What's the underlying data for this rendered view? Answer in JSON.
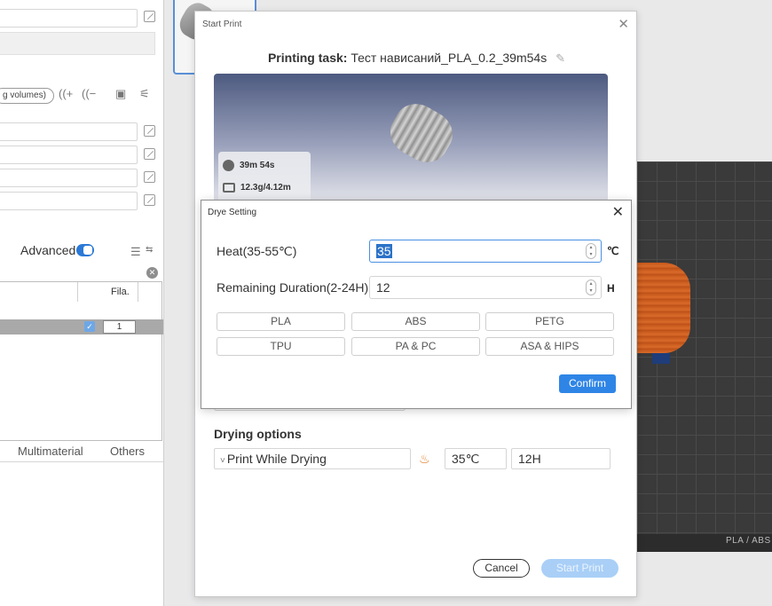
{
  "left_panel": {
    "volumes_pill": "g volumes)",
    "advanced_label": "Advanced",
    "table": {
      "column_fila": "Fila.",
      "row_value": "1"
    },
    "tabs": [
      "Multimaterial",
      "Others"
    ]
  },
  "plate": {
    "label": "PLA / ABS"
  },
  "start_print": {
    "title": "Start Print",
    "task_label": "Printing task:",
    "task_name": "Тест нависаний_PLA_0.2_39m54s",
    "time": "39m 54s",
    "filament": "12.3g/4.12m",
    "drying_title": "Drying options",
    "drying_mode": "Print While Drying",
    "temp_value": "35℃",
    "hours_value": "12H",
    "cancel": "Cancel",
    "start": "Start Print"
  },
  "drye_setting": {
    "title": "Drye Setting",
    "heat_label": "Heat(35-55℃)",
    "heat_value": "35",
    "heat_unit": "℃",
    "duration_label": "Remaining Duration(2-24H)",
    "duration_value": "12",
    "duration_unit": "H",
    "materials": [
      "PLA",
      "ABS",
      "PETG",
      "TPU",
      "PA & PC",
      "ASA & HIPS"
    ],
    "confirm": "Confirm"
  },
  "colors": {
    "accent": "#2f85e6",
    "start_disabled": "#a9cff7",
    "object_orange": "#d96a2a",
    "heat_icon": "#e0781f"
  }
}
